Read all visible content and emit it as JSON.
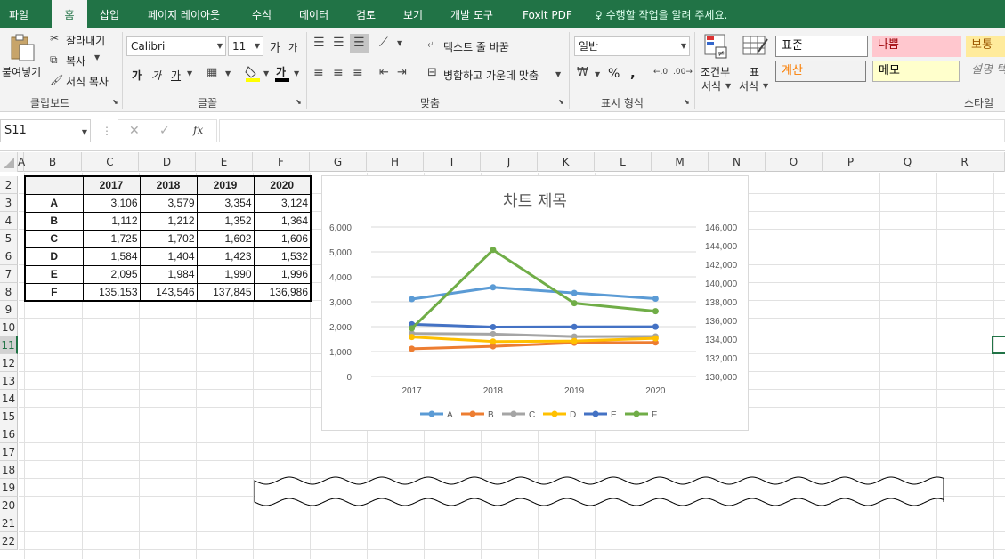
{
  "menu_tabs": [
    "파일",
    "홈",
    "삽입",
    "페이지 레이아웃",
    "수식",
    "데이터",
    "검토",
    "보기",
    "개발 도구",
    "Foxit PDF"
  ],
  "tell_me": "수행할 작업을 알려 주세요.",
  "ribbon": {
    "clipboard": {
      "paste": "붙여넣기",
      "cut": "잘라내기",
      "copy": "복사",
      "format_painter": "서식 복사",
      "label": "클립보드"
    },
    "font": {
      "name": "Calibri",
      "size": "11",
      "label": "글꼴",
      "grow": "가",
      "shrink": "가",
      "bold": "가",
      "italic": "가",
      "underline": "가",
      "font_color_glyph": "가"
    },
    "alignment": {
      "wrap": "텍스트 줄 바꿈",
      "merge": "병합하고 가운데 맞춤",
      "label": "맞춤"
    },
    "number": {
      "format": "일반",
      "percent": "%",
      "comma": ",",
      "label": "표시 형식"
    },
    "styles": {
      "conditional": "조건부",
      "conditional2": "서식",
      "table": "표",
      "table2": "서식",
      "normal": "표준",
      "bad": "나쁨",
      "good": "보통",
      "calc": "계산",
      "memo": "메모",
      "explain": "설명 텍",
      "label": "스타일"
    }
  },
  "formula_bar": {
    "name_box": "S11",
    "fx": "fx",
    "cancel": "✕",
    "enter": "✓",
    "value": ""
  },
  "columns": [
    "A",
    "B",
    "C",
    "D",
    "E",
    "F",
    "G",
    "H",
    "I",
    "J",
    "K",
    "L",
    "M",
    "N",
    "O",
    "P",
    "Q",
    "R"
  ],
  "rows": [
    "2",
    "3",
    "4",
    "5",
    "6",
    "7",
    "8",
    "9",
    "10",
    "11",
    "12",
    "13",
    "14",
    "15",
    "16",
    "17",
    "18",
    "19",
    "20",
    "21",
    "22"
  ],
  "table": {
    "headers": [
      "",
      "2017",
      "2018",
      "2019",
      "2020"
    ],
    "rows": [
      [
        "A",
        "3,106",
        "3,579",
        "3,354",
        "3,124"
      ],
      [
        "B",
        "1,112",
        "1,212",
        "1,352",
        "1,364"
      ],
      [
        "C",
        "1,725",
        "1,702",
        "1,602",
        "1,606"
      ],
      [
        "D",
        "1,584",
        "1,404",
        "1,423",
        "1,532"
      ],
      [
        "E",
        "2,095",
        "1,984",
        "1,990",
        "1,996"
      ],
      [
        "F",
        "135,153",
        "143,546",
        "137,845",
        "136,986"
      ]
    ]
  },
  "chart_data": {
    "type": "line",
    "title": "차트 제목",
    "categories": [
      "2017",
      "2018",
      "2019",
      "2020"
    ],
    "y_left": {
      "min": 0,
      "max": 6000,
      "ticks": [
        "0",
        "1,000",
        "2,000",
        "3,000",
        "4,000",
        "5,000",
        "6,000"
      ]
    },
    "y_right": {
      "min": 130000,
      "max": 146000,
      "ticks": [
        "130,000",
        "132,000",
        "134,000",
        "136,000",
        "138,000",
        "140,000",
        "142,000",
        "144,000",
        "146,000"
      ]
    },
    "series": [
      {
        "name": "A",
        "axis": "left",
        "color": "#5b9bd5",
        "values": [
          3106,
          3579,
          3354,
          3124
        ]
      },
      {
        "name": "B",
        "axis": "left",
        "color": "#ed7d31",
        "values": [
          1112,
          1212,
          1352,
          1364
        ]
      },
      {
        "name": "C",
        "axis": "left",
        "color": "#a5a5a5",
        "values": [
          1725,
          1702,
          1602,
          1606
        ]
      },
      {
        "name": "D",
        "axis": "left",
        "color": "#ffc000",
        "values": [
          1584,
          1404,
          1423,
          1532
        ]
      },
      {
        "name": "E",
        "axis": "left",
        "color": "#4472c4",
        "values": [
          2095,
          1984,
          1990,
          1996
        ]
      },
      {
        "name": "F",
        "axis": "right",
        "color": "#70ad47",
        "values": [
          135153,
          143546,
          137845,
          136986
        ]
      }
    ],
    "grid": true,
    "legend": "bottom"
  },
  "colors": {
    "accent": "#217346",
    "selection": "#217346"
  }
}
